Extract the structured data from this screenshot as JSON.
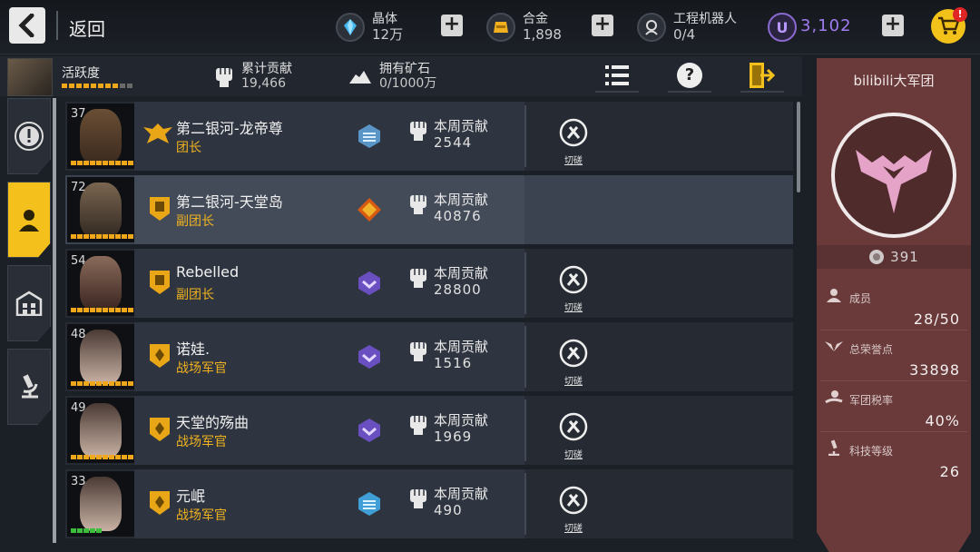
{
  "topbar": {
    "back_label": "返回",
    "resources": [
      {
        "name": "晶体",
        "value": "12万"
      },
      {
        "name": "合金",
        "value": "1,898"
      },
      {
        "name": "工程机器人",
        "value": "0/4"
      }
    ],
    "u_value": "3,102",
    "cart_badge": "!",
    "u_icon_label": "U"
  },
  "subbar": {
    "activity_label": "活跃度",
    "total_contrib_label": "累计贡献",
    "total_contrib_value": "19,466",
    "ore_label": "拥有矿石",
    "ore_value": "0/1000万",
    "help_glyph": "?"
  },
  "members": [
    {
      "level": "37",
      "name": "第二银河-龙帝尊",
      "role": "团长",
      "contrib_label": "本周贡献",
      "contrib_value": "2544",
      "duel_label": "切磋",
      "selected": false
    },
    {
      "level": "72",
      "name": "第二银河-天堂岛",
      "role": "副团长",
      "contrib_label": "本周贡献",
      "contrib_value": "40876",
      "duel_label": "",
      "selected": true
    },
    {
      "level": "54",
      "name": "Rebelled",
      "role": "副团长",
      "contrib_label": "本周贡献",
      "contrib_value": "28800",
      "duel_label": "切磋",
      "selected": false
    },
    {
      "level": "48",
      "name": "诺娃.",
      "role": "战场军官",
      "contrib_label": "本周贡献",
      "contrib_value": "1516",
      "duel_label": "切磋",
      "selected": false
    },
    {
      "level": "49",
      "name": "天堂的殇曲",
      "role": "战场军官",
      "contrib_label": "本周贡献",
      "contrib_value": "1969",
      "duel_label": "切磋",
      "selected": false
    },
    {
      "level": "33",
      "name": "元岷",
      "role": "战场军官",
      "contrib_label": "本周贡献",
      "contrib_value": "490",
      "duel_label": "切磋",
      "selected": false
    }
  ],
  "panel": {
    "title": "bilibili大军团",
    "emblem_count": "391",
    "members_label": "成员",
    "members_value": "28/50",
    "honor_label": "总荣誉点",
    "honor_value": "33898",
    "tax_label": "军团税率",
    "tax_value": "40%",
    "tech_label": "科技等级",
    "tech_value": "26"
  },
  "colors": {
    "accent": "#f3c01c",
    "role": "#efb21e",
    "panel": "#6a3a3a",
    "u_currency": "#a07cf0"
  }
}
